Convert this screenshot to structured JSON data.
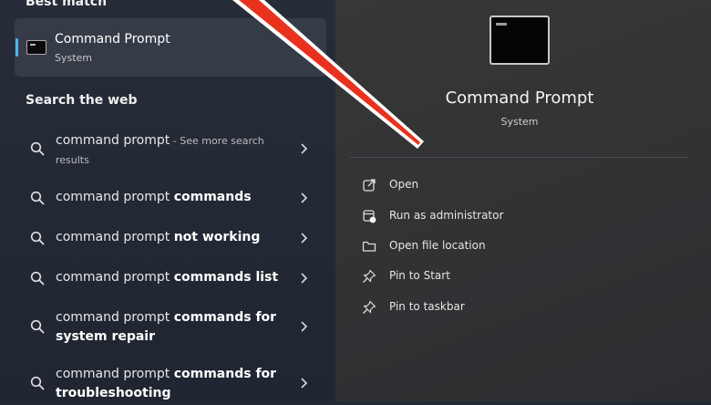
{
  "best_match": {
    "header": "Best match",
    "title": "Command Prompt",
    "subtitle": "System"
  },
  "web": {
    "header": "Search the web",
    "items": [
      {
        "query": "command prompt",
        "bold": "",
        "suffix": " - See more search",
        "suffix2": "results"
      },
      {
        "query": "command prompt ",
        "bold": "commands"
      },
      {
        "query": "command prompt ",
        "bold": "not working"
      },
      {
        "query": "command prompt ",
        "bold": "commands list"
      },
      {
        "query": "command prompt ",
        "bold": "commands for",
        "line2": "system repair"
      },
      {
        "query": "command prompt ",
        "bold": "commands for",
        "line2": "troubleshooting"
      }
    ]
  },
  "detail": {
    "title": "Command Prompt",
    "subtitle": "System",
    "actions": [
      {
        "label": "Open",
        "icon": "open-icon"
      },
      {
        "label": "Run as administrator",
        "icon": "shield-icon"
      },
      {
        "label": "Open file location",
        "icon": "folder-icon"
      },
      {
        "label": "Pin to Start",
        "icon": "pin-icon"
      },
      {
        "label": "Pin to taskbar",
        "icon": "pin-icon"
      }
    ]
  },
  "colors": {
    "accent": "#4fb3f0",
    "annotation_arrow": "#e8321e"
  }
}
